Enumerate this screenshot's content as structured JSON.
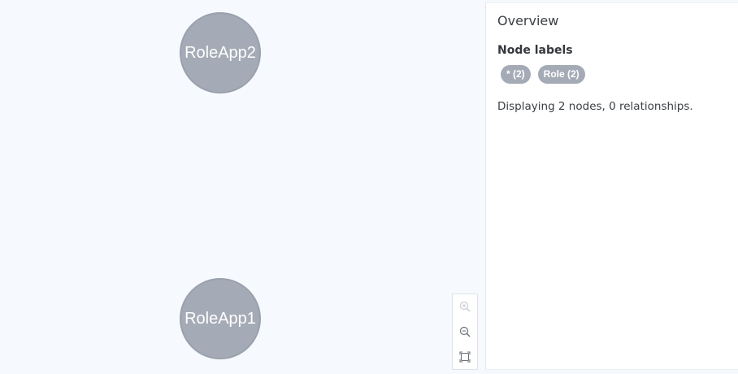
{
  "graph": {
    "nodes": [
      {
        "caption": "RoleApp2"
      },
      {
        "caption": "RoleApp1"
      }
    ]
  },
  "zoom_controls": {
    "zoom_in_icon": "zoom-in-icon",
    "zoom_out_icon": "zoom-out-icon",
    "fit_icon": "fit-to-screen-icon"
  },
  "overview": {
    "title": "Overview",
    "node_labels_heading": "Node labels",
    "labels": [
      {
        "text": "* (2)"
      },
      {
        "text": "Role (2)"
      }
    ],
    "summary": "Displaying 2 nodes, 0 relationships."
  },
  "colors": {
    "node_fill": "#a5abb6",
    "canvas_bg": "#f6f9fd"
  }
}
